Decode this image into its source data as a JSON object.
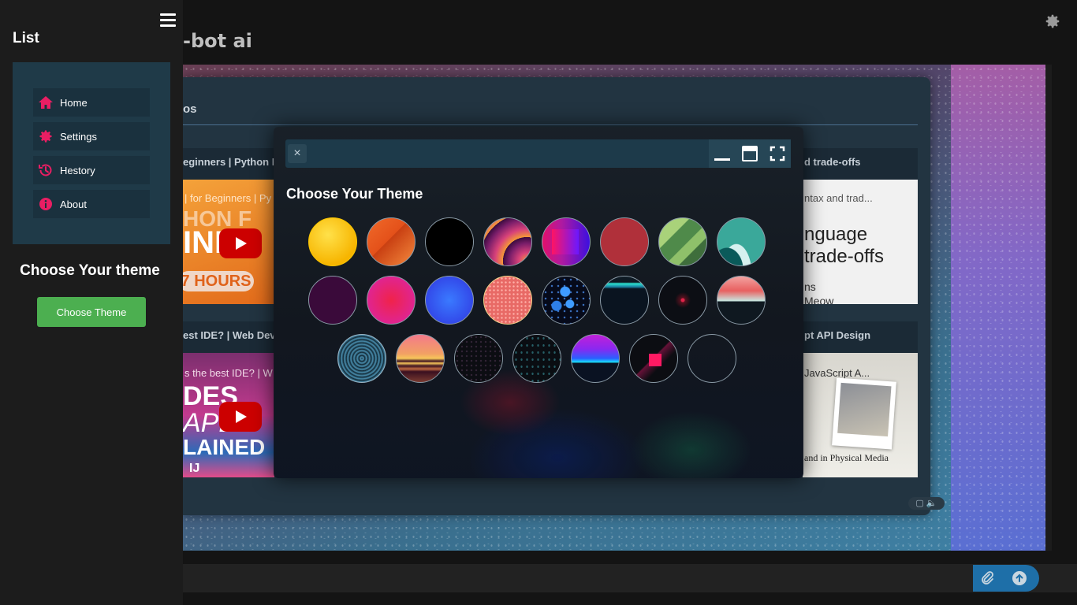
{
  "app": {
    "title": "-bot ai"
  },
  "sidebar": {
    "title": "List",
    "items": [
      {
        "label": "Home",
        "icon": "home-icon"
      },
      {
        "label": "Settings",
        "icon": "gear-icon"
      },
      {
        "label": "Hestory",
        "icon": "history-icon"
      },
      {
        "label": "About",
        "icon": "info-icon"
      }
    ],
    "theme_heading": "Choose Your theme",
    "theme_button": "Choose Theme",
    "accent": "#e91e63",
    "button_color": "#4caf50"
  },
  "panel": {
    "heading": "os",
    "videos": [
      {
        "title": "eginners | Python Fu",
        "caption": "| for Beginners | Py",
        "thumb_text_1": "HON F",
        "thumb_text_2": "INNE",
        "thumb_badge": "7 HOURS"
      },
      {
        "title": "d trade-offs",
        "caption": "ntax and trad...",
        "thumb_text_1": "nguage",
        "thumb_text_2": "trade-offs",
        "thumb_text_3": "ns",
        "thumb_text_4": "Meow"
      },
      {
        "title": "est IDE? | Web Deve",
        "caption": "s the best IDE? | W",
        "thumb_text_1": "DES",
        "thumb_text_2": "APL",
        "thumb_text_3": "LAINED",
        "thumb_text_4": "IJ"
      },
      {
        "title": "pt API Design",
        "caption": "JavaScript A...",
        "thumb_text_1": "and in Physical Media"
      }
    ]
  },
  "modal": {
    "close_label": "×",
    "title": "Choose Your Theme",
    "themes": [
      "yellow-gradient",
      "orange-facets",
      "black",
      "sunset-rings",
      "pink-square",
      "crimson",
      "green-stripes",
      "teal-waves",
      "deep-purple",
      "magenta-glow",
      "blue-glow",
      "coral-speckle",
      "blue-cubes",
      "dark-horizon",
      "dark-spark",
      "peach-mountains",
      "dark-vortex",
      "retro-sun",
      "dark-dots",
      "dark-stars",
      "neon-horizon",
      "pink-cube",
      "empty"
    ]
  }
}
